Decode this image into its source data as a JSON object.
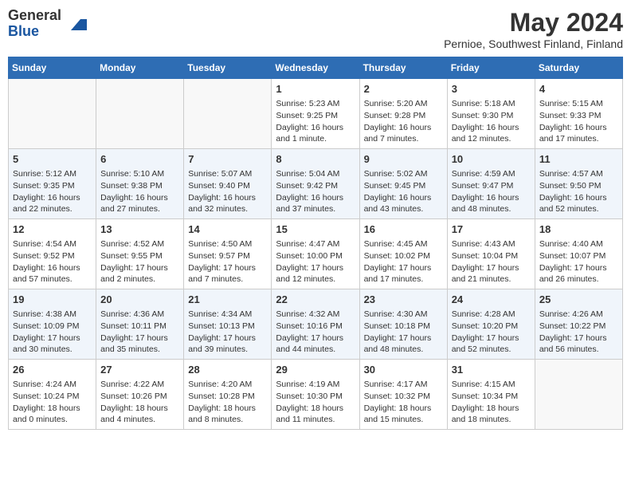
{
  "logo": {
    "general": "General",
    "blue": "Blue"
  },
  "title": "May 2024",
  "location": "Pernioe, Southwest Finland, Finland",
  "days_of_week": [
    "Sunday",
    "Monday",
    "Tuesday",
    "Wednesday",
    "Thursday",
    "Friday",
    "Saturday"
  ],
  "weeks": [
    [
      {
        "day": "",
        "info": ""
      },
      {
        "day": "",
        "info": ""
      },
      {
        "day": "",
        "info": ""
      },
      {
        "day": "1",
        "info": "Sunrise: 5:23 AM\nSunset: 9:25 PM\nDaylight: 16 hours\nand 1 minute."
      },
      {
        "day": "2",
        "info": "Sunrise: 5:20 AM\nSunset: 9:28 PM\nDaylight: 16 hours\nand 7 minutes."
      },
      {
        "day": "3",
        "info": "Sunrise: 5:18 AM\nSunset: 9:30 PM\nDaylight: 16 hours\nand 12 minutes."
      },
      {
        "day": "4",
        "info": "Sunrise: 5:15 AM\nSunset: 9:33 PM\nDaylight: 16 hours\nand 17 minutes."
      }
    ],
    [
      {
        "day": "5",
        "info": "Sunrise: 5:12 AM\nSunset: 9:35 PM\nDaylight: 16 hours\nand 22 minutes."
      },
      {
        "day": "6",
        "info": "Sunrise: 5:10 AM\nSunset: 9:38 PM\nDaylight: 16 hours\nand 27 minutes."
      },
      {
        "day": "7",
        "info": "Sunrise: 5:07 AM\nSunset: 9:40 PM\nDaylight: 16 hours\nand 32 minutes."
      },
      {
        "day": "8",
        "info": "Sunrise: 5:04 AM\nSunset: 9:42 PM\nDaylight: 16 hours\nand 37 minutes."
      },
      {
        "day": "9",
        "info": "Sunrise: 5:02 AM\nSunset: 9:45 PM\nDaylight: 16 hours\nand 43 minutes."
      },
      {
        "day": "10",
        "info": "Sunrise: 4:59 AM\nSunset: 9:47 PM\nDaylight: 16 hours\nand 48 minutes."
      },
      {
        "day": "11",
        "info": "Sunrise: 4:57 AM\nSunset: 9:50 PM\nDaylight: 16 hours\nand 52 minutes."
      }
    ],
    [
      {
        "day": "12",
        "info": "Sunrise: 4:54 AM\nSunset: 9:52 PM\nDaylight: 16 hours\nand 57 minutes."
      },
      {
        "day": "13",
        "info": "Sunrise: 4:52 AM\nSunset: 9:55 PM\nDaylight: 17 hours\nand 2 minutes."
      },
      {
        "day": "14",
        "info": "Sunrise: 4:50 AM\nSunset: 9:57 PM\nDaylight: 17 hours\nand 7 minutes."
      },
      {
        "day": "15",
        "info": "Sunrise: 4:47 AM\nSunset: 10:00 PM\nDaylight: 17 hours\nand 12 minutes."
      },
      {
        "day": "16",
        "info": "Sunrise: 4:45 AM\nSunset: 10:02 PM\nDaylight: 17 hours\nand 17 minutes."
      },
      {
        "day": "17",
        "info": "Sunrise: 4:43 AM\nSunset: 10:04 PM\nDaylight: 17 hours\nand 21 minutes."
      },
      {
        "day": "18",
        "info": "Sunrise: 4:40 AM\nSunset: 10:07 PM\nDaylight: 17 hours\nand 26 minutes."
      }
    ],
    [
      {
        "day": "19",
        "info": "Sunrise: 4:38 AM\nSunset: 10:09 PM\nDaylight: 17 hours\nand 30 minutes."
      },
      {
        "day": "20",
        "info": "Sunrise: 4:36 AM\nSunset: 10:11 PM\nDaylight: 17 hours\nand 35 minutes."
      },
      {
        "day": "21",
        "info": "Sunrise: 4:34 AM\nSunset: 10:13 PM\nDaylight: 17 hours\nand 39 minutes."
      },
      {
        "day": "22",
        "info": "Sunrise: 4:32 AM\nSunset: 10:16 PM\nDaylight: 17 hours\nand 44 minutes."
      },
      {
        "day": "23",
        "info": "Sunrise: 4:30 AM\nSunset: 10:18 PM\nDaylight: 17 hours\nand 48 minutes."
      },
      {
        "day": "24",
        "info": "Sunrise: 4:28 AM\nSunset: 10:20 PM\nDaylight: 17 hours\nand 52 minutes."
      },
      {
        "day": "25",
        "info": "Sunrise: 4:26 AM\nSunset: 10:22 PM\nDaylight: 17 hours\nand 56 minutes."
      }
    ],
    [
      {
        "day": "26",
        "info": "Sunrise: 4:24 AM\nSunset: 10:24 PM\nDaylight: 18 hours\nand 0 minutes."
      },
      {
        "day": "27",
        "info": "Sunrise: 4:22 AM\nSunset: 10:26 PM\nDaylight: 18 hours\nand 4 minutes."
      },
      {
        "day": "28",
        "info": "Sunrise: 4:20 AM\nSunset: 10:28 PM\nDaylight: 18 hours\nand 8 minutes."
      },
      {
        "day": "29",
        "info": "Sunrise: 4:19 AM\nSunset: 10:30 PM\nDaylight: 18 hours\nand 11 minutes."
      },
      {
        "day": "30",
        "info": "Sunrise: 4:17 AM\nSunset: 10:32 PM\nDaylight: 18 hours\nand 15 minutes."
      },
      {
        "day": "31",
        "info": "Sunrise: 4:15 AM\nSunset: 10:34 PM\nDaylight: 18 hours\nand 18 minutes."
      },
      {
        "day": "",
        "info": ""
      }
    ]
  ]
}
